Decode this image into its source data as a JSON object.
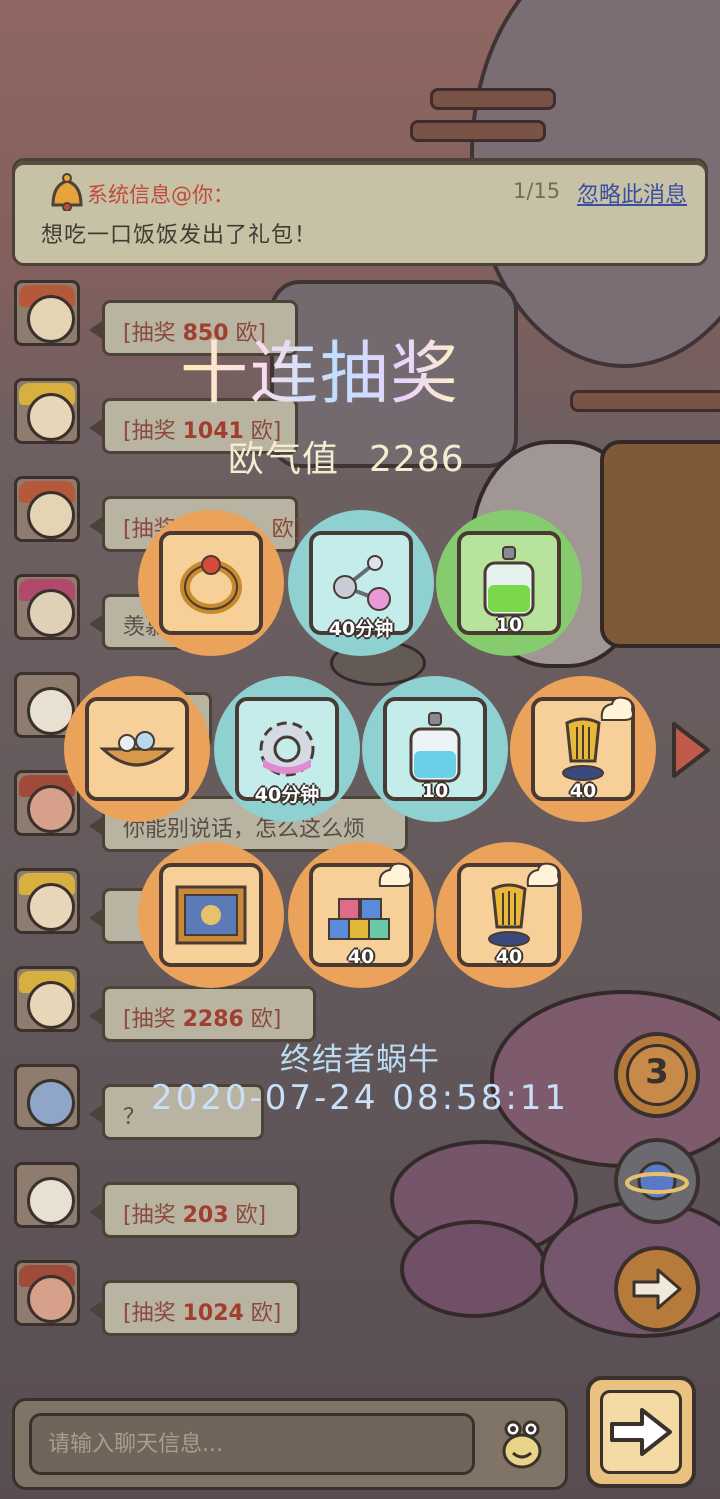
{
  "system_message": {
    "title": "系统信息@你：",
    "counter": "1/15",
    "ignore_label": "忽略此消息",
    "text": "想吃一口饭饭发出了礼包！"
  },
  "chat": [
    {
      "prefix": "[抽奖 ",
      "amount": "850",
      "suffix": " 欧]"
    },
    {
      "prefix": "[抽奖 ",
      "amount": "1041",
      "suffix": " 欧]"
    },
    {
      "prefix": "[抽奖",
      "amount": "",
      "suffix": "欧]"
    },
    {
      "prefix": "羡慕",
      "amount": "",
      "suffix": ""
    },
    {
      "prefix": "",
      "amount": "",
      "suffix": ""
    },
    {
      "prefix": "你能别说话，怎么这么烦",
      "amount": "",
      "suffix": ""
    },
    {
      "prefix": "",
      "amount": "",
      "suffix": ""
    },
    {
      "prefix": "[抽奖 ",
      "amount": "2286",
      "suffix": " 欧]"
    },
    {
      "prefix": "？",
      "amount": "",
      "suffix": ""
    },
    {
      "prefix": "[抽奖 ",
      "amount": "203",
      "suffix": " 欧]"
    },
    {
      "prefix": "[抽奖 ",
      "amount": "1024",
      "suffix": " 欧]"
    }
  ],
  "lottery": {
    "title": "十连抽奖",
    "luck_label": "欧气值",
    "luck_value": "2286",
    "items": [
      {
        "name": "ring",
        "qty": "",
        "color": "orange"
      },
      {
        "name": "molecule",
        "qty": "40分钟",
        "color": "teal"
      },
      {
        "name": "green-potion",
        "qty": "10",
        "color": "green"
      },
      {
        "name": "boat",
        "qty": "",
        "color": "orange"
      },
      {
        "name": "gear",
        "qty": "40分钟",
        "color": "teal"
      },
      {
        "name": "blue-potion",
        "qty": "10",
        "color": "teal"
      },
      {
        "name": "harp-trophy",
        "qty": "40",
        "color": "orange"
      },
      {
        "name": "painting",
        "qty": "",
        "color": "orange"
      },
      {
        "name": "blocks",
        "qty": "40",
        "color": "orange"
      },
      {
        "name": "harp-trophy",
        "qty": "40",
        "color": "orange"
      }
    ],
    "winner": "终结者蜗牛",
    "timestamp": "2020-07-24  08:58:11"
  },
  "side_buttons": {
    "count_badge": "3"
  },
  "input": {
    "placeholder": "请输入聊天信息..."
  },
  "colors": {
    "orange_ring": "#eba25a",
    "teal_ring": "#8fd0d0",
    "green_ring": "#86cc6e",
    "link": "#3b4fa0"
  }
}
